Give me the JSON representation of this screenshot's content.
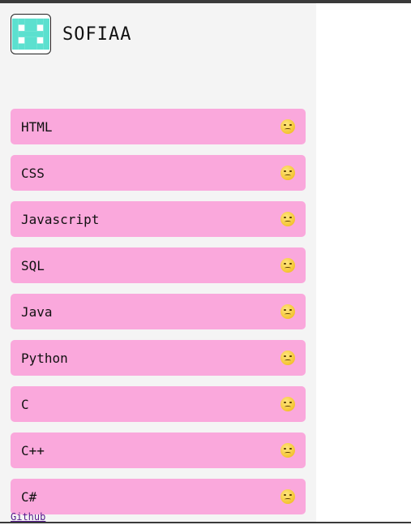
{
  "brand": {
    "name": "SOFIAA",
    "logo_icon": "pixel-logo-icon",
    "logo_color": "#5ce0cf"
  },
  "languages": [
    {
      "label": "HTML",
      "emoji": "confounded-face-icon"
    },
    {
      "label": "CSS",
      "emoji": "sad-sweat-face-icon"
    },
    {
      "label": "Javascript",
      "emoji": "sleeping-face-icon"
    },
    {
      "label": "SQL",
      "emoji": "smirking-face-icon"
    },
    {
      "label": "Java",
      "emoji": "crying-face-icon"
    },
    {
      "label": "Python",
      "emoji": "downcast-sweat-face-icon"
    },
    {
      "label": "C",
      "emoji": "persevering-face-icon"
    },
    {
      "label": "C++",
      "emoji": "disappointed-face-icon"
    },
    {
      "label": "C#",
      "emoji": "weary-face-icon"
    }
  ],
  "footer": {
    "github_label": "Github"
  },
  "colors": {
    "item_bg": "#faa8dc",
    "sidebar_bg": "#f4f4f4"
  }
}
